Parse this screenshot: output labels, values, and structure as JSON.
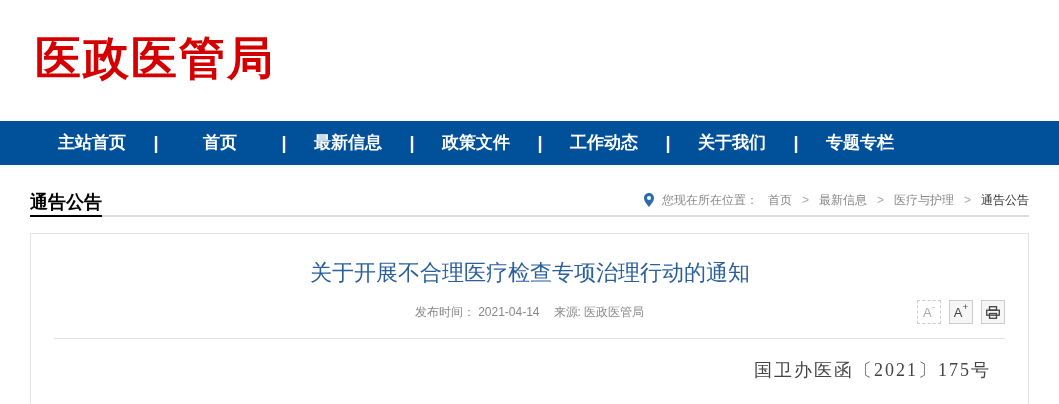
{
  "logo": {
    "text": "医政医管局"
  },
  "nav": {
    "items": [
      {
        "label": "主站首页",
        "separator": "|"
      },
      {
        "label": "首页",
        "separator": "|"
      },
      {
        "label": "最新信息",
        "separator": "|"
      },
      {
        "label": "政策文件",
        "separator": "|"
      },
      {
        "label": "工作动态",
        "separator": "|"
      },
      {
        "label": "关于我们",
        "separator": "|"
      },
      {
        "label": "专题专栏"
      }
    ]
  },
  "section": {
    "title": "通告公告",
    "breadcrumb": {
      "prefix": "您现在所在位置：",
      "items": [
        {
          "label": "首页",
          "separator": ">"
        },
        {
          "label": "最新信息",
          "separator": ">"
        },
        {
          "label": "医疗与护理",
          "separator": ">"
        },
        {
          "label": "通告公告"
        }
      ]
    }
  },
  "article": {
    "title": "关于开展不合理医疗检查专项治理行动的通知",
    "published_label": "发布时间：",
    "published": "2021-04-14",
    "source_label": "来源:",
    "source": "医政医管局",
    "tools": [
      {
        "kind": "font-smaller",
        "label": "A$^{-}$",
        "disabled": true
      },
      {
        "kind": "font-larger",
        "label": "A$^{+}$",
        "disabled": false
      },
      {
        "kind": "print",
        "disabled": false
      }
    ],
    "doc_number": "国卫办医函〔2021〕175号"
  }
}
